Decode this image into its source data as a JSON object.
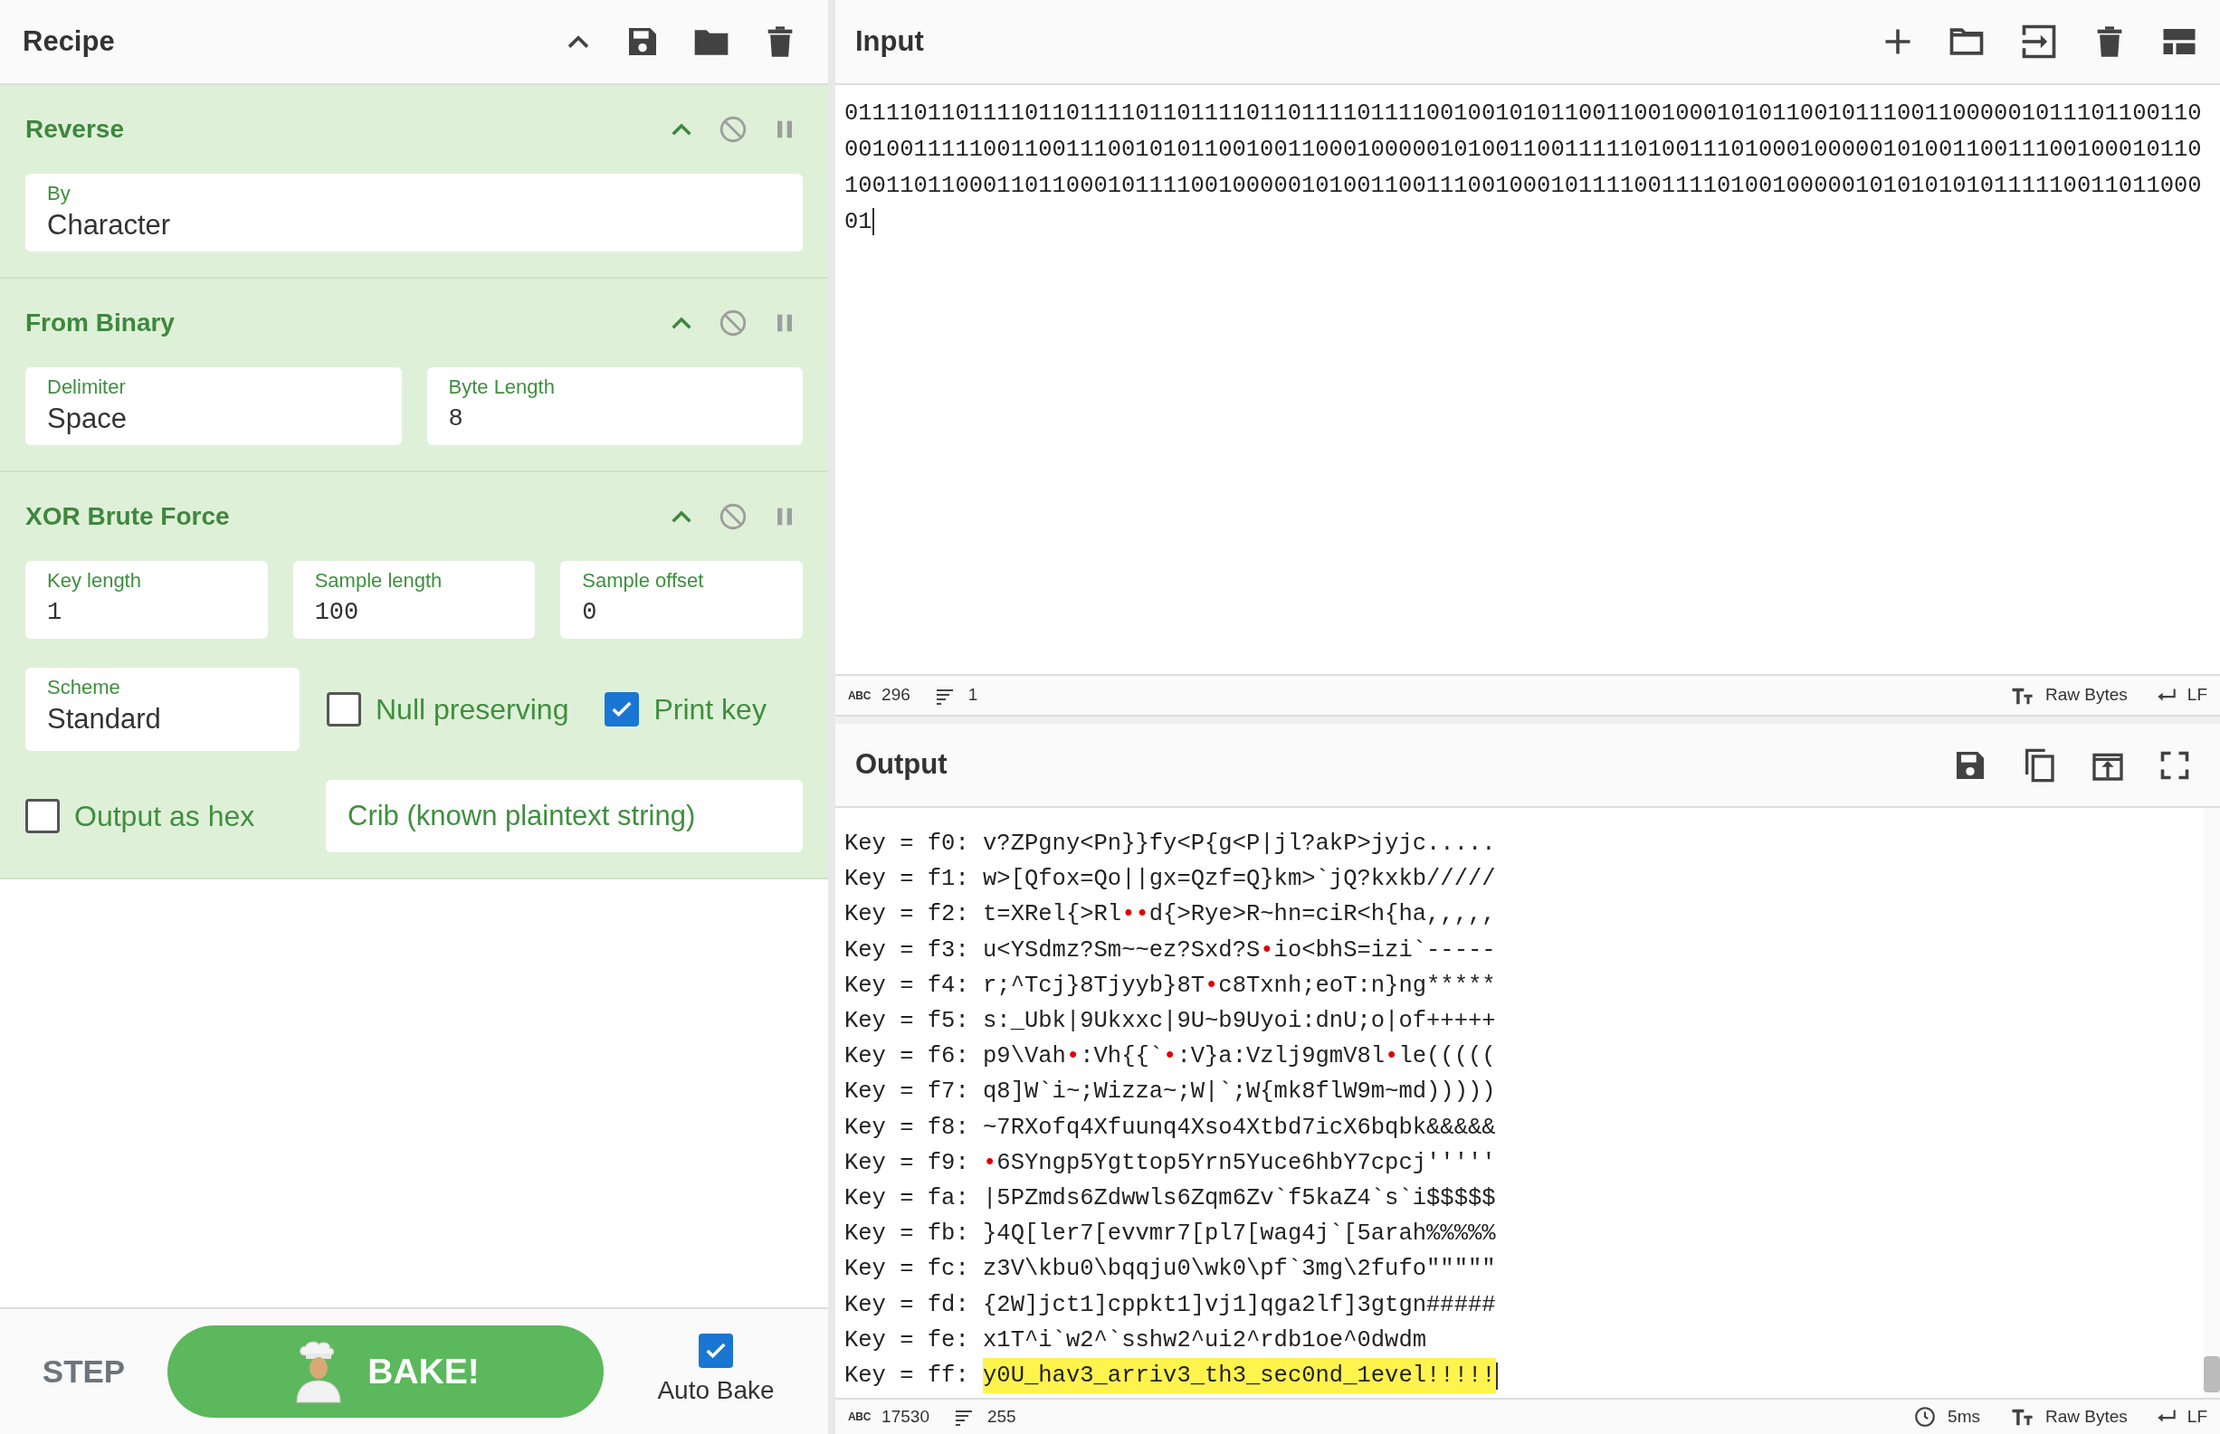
{
  "recipe": {
    "title": "Recipe"
  },
  "operations": [
    {
      "name": "Reverse",
      "rows": [
        [
          {
            "kind": "dropdown",
            "label": "By",
            "value": "Character"
          }
        ]
      ]
    },
    {
      "name": "From Binary",
      "rows": [
        [
          {
            "kind": "dropdown",
            "label": "Delimiter",
            "value": "Space"
          },
          {
            "kind": "number",
            "label": "Byte Length",
            "value": "8"
          }
        ]
      ]
    },
    {
      "name": "XOR Brute Force",
      "rows": [
        [
          {
            "kind": "number",
            "label": "Key length",
            "value": "1"
          },
          {
            "kind": "number",
            "label": "Sample length",
            "value": "100"
          },
          {
            "kind": "number",
            "label": "Sample offset",
            "value": "0"
          }
        ],
        [
          {
            "kind": "dropdown",
            "label": "Scheme",
            "value": "Standard"
          },
          {
            "kind": "checkbox",
            "label": "Null preserving",
            "checked": false
          },
          {
            "kind": "checkbox",
            "label": "Print key",
            "checked": true
          }
        ],
        [
          {
            "kind": "checkbox",
            "label": "Output as hex",
            "checked": false
          },
          {
            "kind": "text-input",
            "placeholder": "Crib (known plaintext string)"
          }
        ]
      ]
    }
  ],
  "controls": {
    "step": "STEP",
    "bake": "BAKE!",
    "auto_bake": {
      "label": "Auto Bake",
      "checked": true
    }
  },
  "input": {
    "title": "Input",
    "text": "01111011011110110111101101111011011110111100100101011001100100010101100101110011000001011101100110001001111100110011100101011001001100010000010100110011111010011101000100000101001100111001000101101001101100011011000101111001000001010011001110010001011110011110100100000101010101011111001101100001",
    "status": {
      "length_icon": "ABC",
      "length": "296",
      "lines": "1",
      "encoding": "Raw Bytes",
      "eol": "LF"
    }
  },
  "output": {
    "title": "Output",
    "lines": [
      {
        "key": "Key = f0:",
        "text": "v?ZPgny<Pn}}fy<P{g<P|jl?akP>jyjc.....",
        "highlighted": false
      },
      {
        "key": "Key = f1:",
        "text": "w>[Qfox=Qo||gx=Qzf=Q}km>`jQ?kxkb/////",
        "highlighted": false
      },
      {
        "key": "Key = f2:",
        "text": "t=XRel{>Rl••d{>Rye>R~hn=ciR<h{ha,,,,,",
        "highlighted": false
      },
      {
        "key": "Key = f3:",
        "text": "u<YSdmz?Sm~~ez?Sxd?S•io<bhS=izi`-----",
        "highlighted": false
      },
      {
        "key": "Key = f4:",
        "text": "r;^Tcj}8Tjyyb}8T•c8Txnh;eoT:n}ng*****",
        "highlighted": false
      },
      {
        "key": "Key = f5:",
        "text": "s:_Ubk|9Ukxxc|9U~b9Uyoi:dnU;o|of+++++",
        "highlighted": false
      },
      {
        "key": "Key = f6:",
        "text": "p9\\Vah•:Vh{{`•:V}a:Vzlj9gmV8l•le(((((",
        "highlighted": false
      },
      {
        "key": "Key = f7:",
        "text": "q8]W`i~;Wizza~;W|`;W{mk8flW9m~md)))))",
        "highlighted": false
      },
      {
        "key": "Key = f8:",
        "text": "~7RXofq4Xfuunq4Xso4Xtbd7icX6bqbk&&&&&",
        "highlighted": false
      },
      {
        "key": "Key = f9:",
        "text": "•6SYngp5Ygttop5Yrn5Yuce6hbY7cpcj'''''",
        "highlighted": false
      },
      {
        "key": "Key = fa:",
        "text": "|5PZmds6Zdwwls6Zqm6Zv`f5kaZ4`s`i$$$$$",
        "highlighted": false
      },
      {
        "key": "Key = fb:",
        "text": "}4Q[ler7[evvmr7[pl7[wag4j`[5arah%%%%%",
        "highlighted": false
      },
      {
        "key": "Key = fc:",
        "text": "z3V\\kbu0\\bqqju0\\wk0\\pf`3mg\\2fufo\"\"\"\"\"",
        "highlighted": false
      },
      {
        "key": "Key = fd:",
        "text": "{2W]jct1]cppkt1]vj1]qga2lf]3gtgn#####",
        "highlighted": false
      },
      {
        "key": "Key = fe:",
        "text": "x1T^i`w2^`sshw2^ui2^rdb1oe^0dwdm",
        "highlighted": false
      },
      {
        "key": "Key = ff:",
        "text": "y0U_hav3_arriv3_th3_sec0nd_1evel!!!!!",
        "highlighted": true
      }
    ],
    "status": {
      "length_icon": "ABC",
      "length": "17530",
      "lines": "255",
      "time": "5ms",
      "encoding": "Raw Bytes",
      "eol": "LF"
    }
  }
}
